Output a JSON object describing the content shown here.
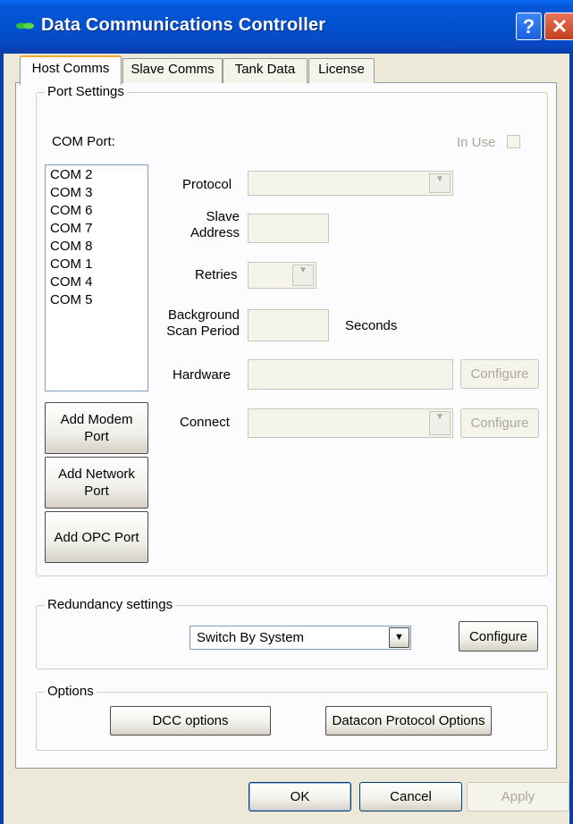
{
  "window": {
    "title": "Data Communications Controller",
    "help_label": "?",
    "close_label": "✕"
  },
  "tabs": [
    {
      "label": "Host Comms"
    },
    {
      "label": "Slave Comms"
    },
    {
      "label": "Tank Data"
    },
    {
      "label": "License"
    }
  ],
  "port_settings": {
    "legend": "Port Settings",
    "com_port_label": "COM Port:",
    "in_use_label": "In Use",
    "com_ports": [
      "COM 2",
      "COM 3",
      "COM 6",
      "COM 7",
      "COM 8",
      "COM 1",
      "COM 4",
      "COM 5"
    ],
    "protocol_label": "Protocol",
    "slave_address_label_1": "Slave",
    "slave_address_label_2": "Address",
    "retries_label": "Retries",
    "scan_label_1": "Background",
    "scan_label_2": "Scan Period",
    "seconds_label": "Seconds",
    "hardware_label": "Hardware",
    "connect_label": "Connect",
    "configure_label": "Configure",
    "add_modem_1": "Add Modem",
    "add_modem_2": "Port",
    "add_network_1": "Add Network",
    "add_network_2": "Port",
    "add_opc": "Add OPC Port"
  },
  "redundancy": {
    "legend": "Redundancy settings",
    "selected": "Switch By System",
    "configure_label": "Configure"
  },
  "options": {
    "legend": "Options",
    "dcc_label": "DCC options",
    "datacon_label": "Datacon Protocol Options"
  },
  "footer": {
    "ok": "OK",
    "cancel": "Cancel",
    "apply": "Apply"
  },
  "colors": {
    "titlebar": "#0051cf",
    "face": "#ece9d8",
    "tab_active_accent": "#f2a634"
  }
}
